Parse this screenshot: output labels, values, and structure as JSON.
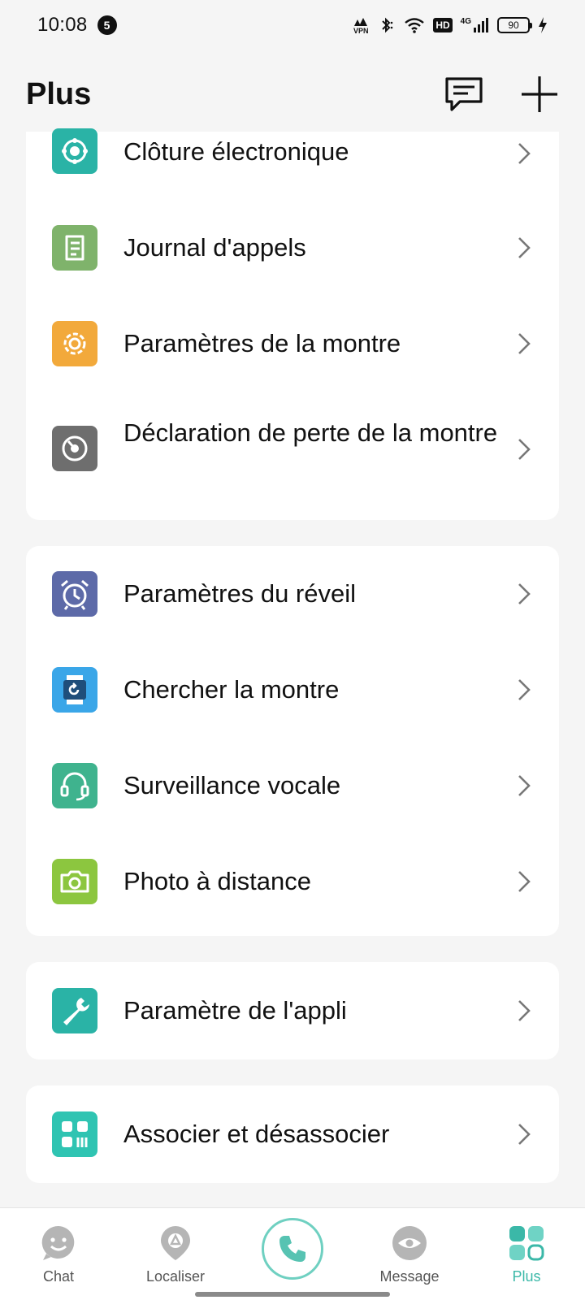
{
  "status_bar": {
    "time": "10:08",
    "notification_count": "5",
    "vpn_label": "VPN",
    "hd_label": "HD",
    "network_label": "4G",
    "battery": "90"
  },
  "header": {
    "title": "Plus"
  },
  "sections": [
    {
      "items": [
        {
          "label": "Clôture électronique",
          "icon": "geofence-icon",
          "color": "#2ab3a6"
        },
        {
          "label": "Journal d'appels",
          "icon": "call-log-icon",
          "color": "#7fb36b"
        },
        {
          "label": "Paramètres de la montre",
          "icon": "gear-icon",
          "color": "#f2a93b"
        },
        {
          "label": "Déclaration de perte de la montre",
          "icon": "lost-watch-icon",
          "color": "#6e6e6e"
        }
      ]
    },
    {
      "items": [
        {
          "label": "Paramètres du réveil",
          "icon": "alarm-clock-icon",
          "color": "#5d6aa8"
        },
        {
          "label": "Chercher la montre",
          "icon": "find-watch-icon",
          "color": "#3aa6e8"
        },
        {
          "label": "Surveillance vocale",
          "icon": "headset-icon",
          "color": "#3fb38e"
        },
        {
          "label": "Photo à distance",
          "icon": "camera-icon",
          "color": "#8cc63f"
        }
      ]
    },
    {
      "items": [
        {
          "label": "Paramètre de l'appli",
          "icon": "wrench-icon",
          "color": "#2ab3a6"
        }
      ]
    },
    {
      "items": [
        {
          "label": "Associer et désassocier",
          "icon": "pair-icon",
          "color": "#2fc4b2"
        }
      ]
    }
  ],
  "bottom_nav": {
    "items": [
      {
        "label": "Chat",
        "icon": "smiley-icon"
      },
      {
        "label": "Localiser",
        "icon": "location-pin-icon"
      },
      {
        "label": "Message",
        "icon": "eye-icon"
      },
      {
        "label": "Plus",
        "icon": "grid-icon",
        "active": true
      }
    ],
    "accent": "#3bb8a8"
  }
}
